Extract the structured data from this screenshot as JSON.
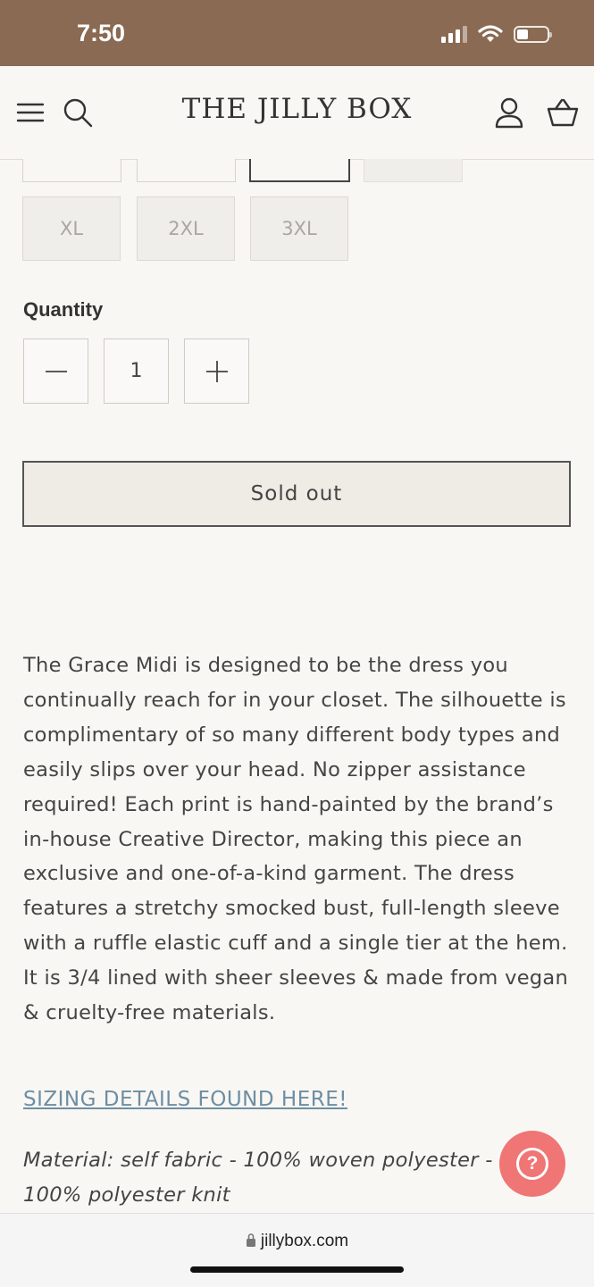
{
  "status_bar": {
    "time": "7:50",
    "icons": [
      "cellular-signal-icon",
      "wifi-icon",
      "battery-icon"
    ]
  },
  "header": {
    "brand": "THE JILLY BOX",
    "icons": [
      "menu-icon",
      "search-icon",
      "account-icon",
      "cart-icon"
    ]
  },
  "sizes": {
    "visible_options": [
      "XL",
      "2XL",
      "3XL"
    ],
    "availability": "unavailable"
  },
  "quantity": {
    "label": "Quantity",
    "value": "1",
    "decrement_icon": "minus-icon",
    "increment_icon": "plus-icon"
  },
  "sold_out_label": "Sold out",
  "description": "The Grace Midi is designed to be the dress you continually reach for in your closet. The silhouette is complimentary of so many different body types and easily slips over your head. No zipper assistance required! Each print is hand-painted by the brand’s in-house Creative Director, making this piece an exclusive and one-of-a-kind garment. The dress features a stretchy smocked bust, full-length sleeve with a ruffle elastic cuff and a single tier at the hem. It is 3/4 lined with sheer sleeves & made from vegan & cruelty-free materials.",
  "sizing_link": "SIZING DETAILS FOUND HERE!",
  "material": "Material: self fabric - 100% woven polyester - 100% polyester knit",
  "help_button": {
    "icon": "question-mark-icon",
    "color": "#f07575"
  },
  "browser": {
    "url": "jillybox.com",
    "icon": "lock-icon"
  },
  "colors": {
    "status_bar": "#8a6a52",
    "background": "#f9f7f4",
    "link": "#6d8ea3",
    "help": "#f07575"
  }
}
